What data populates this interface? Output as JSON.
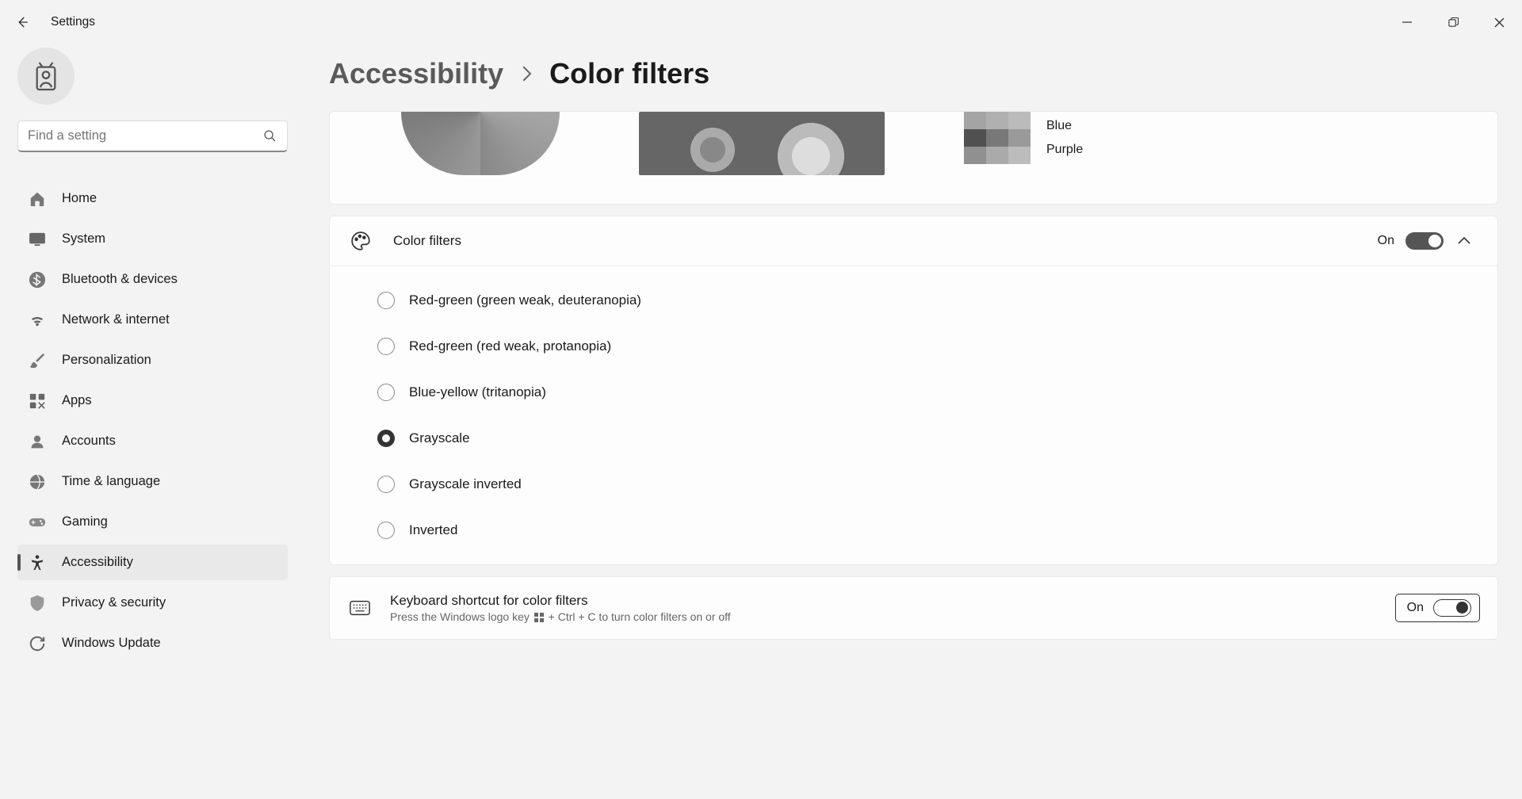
{
  "app_title": "Settings",
  "search": {
    "placeholder": "Find a setting"
  },
  "nav": {
    "items": [
      {
        "label": "Home"
      },
      {
        "label": "System"
      },
      {
        "label": "Bluetooth & devices"
      },
      {
        "label": "Network & internet"
      },
      {
        "label": "Personalization"
      },
      {
        "label": "Apps"
      },
      {
        "label": "Accounts"
      },
      {
        "label": "Time & language"
      },
      {
        "label": "Gaming"
      },
      {
        "label": "Accessibility"
      },
      {
        "label": "Privacy & security"
      },
      {
        "label": "Windows Update"
      }
    ],
    "active_index": 9
  },
  "breadcrumb": {
    "parent": "Accessibility",
    "current": "Color filters"
  },
  "preview": {
    "color_names": [
      "Blue",
      "Purple"
    ]
  },
  "color_filters_section": {
    "title": "Color filters",
    "toggle_state_label": "On",
    "toggle_on": true,
    "options": [
      {
        "label": "Red-green (green weak, deuteranopia)",
        "checked": false
      },
      {
        "label": "Red-green (red weak, protanopia)",
        "checked": false
      },
      {
        "label": "Blue-yellow (tritanopia)",
        "checked": false
      },
      {
        "label": "Grayscale",
        "checked": true
      },
      {
        "label": "Grayscale inverted",
        "checked": false
      },
      {
        "label": "Inverted",
        "checked": false
      }
    ]
  },
  "keyboard_shortcut": {
    "title": "Keyboard shortcut for color filters",
    "subtitle_pre": "Press the Windows logo key ",
    "subtitle_post": " + Ctrl + C to turn color filters on or off",
    "toggle_state_label": "On",
    "toggle_on": true
  }
}
